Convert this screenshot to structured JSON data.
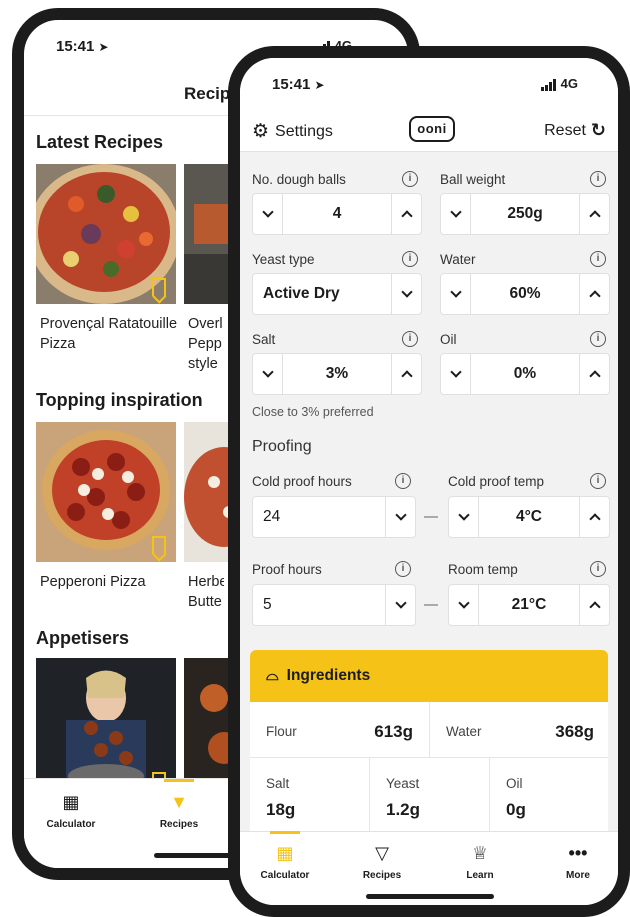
{
  "back_phone": {
    "status": {
      "time": "15:41",
      "network": "4G"
    },
    "header_title": "Recip",
    "sections": [
      {
        "title": "Latest Recipes",
        "cards": [
          {
            "caption": "Provençal Ratatouille Pizza"
          },
          {
            "caption": "Overl Pepp style"
          }
        ]
      },
      {
        "title": "Topping inspiration",
        "cards": [
          {
            "caption": "Pepperoni Pizza"
          },
          {
            "caption": "Herbe Butte"
          }
        ]
      },
      {
        "title": "Appetisers",
        "cards": [
          {
            "caption": ""
          },
          {
            "caption": ""
          }
        ]
      }
    ],
    "tabs": [
      {
        "label": "Calculator",
        "icon": "calculator-icon"
      },
      {
        "label": "Recipes",
        "icon": "pizza-slice-icon",
        "active": true
      }
    ]
  },
  "front_phone": {
    "status": {
      "time": "15:41",
      "network": "4G"
    },
    "nav": {
      "settings_label": "Settings",
      "logo_text": "ooni",
      "reset_label": "Reset"
    },
    "fields": {
      "dough_balls": {
        "label": "No. dough balls",
        "value": "4"
      },
      "ball_weight": {
        "label": "Ball weight",
        "value": "250g"
      },
      "yeast_type": {
        "label": "Yeast type",
        "value": "Active Dry"
      },
      "water": {
        "label": "Water",
        "value": "60%"
      },
      "salt": {
        "label": "Salt",
        "value": "3%"
      },
      "oil": {
        "label": "Oil",
        "value": "0%"
      },
      "salt_hint": "Close to 3% preferred",
      "proofing_title": "Proofing",
      "cold_proof_hours": {
        "label": "Cold proof hours",
        "value": "24"
      },
      "cold_proof_temp": {
        "label": "Cold proof temp",
        "value": "4°C"
      },
      "proof_hours": {
        "label": "Proof hours",
        "value": "5"
      },
      "room_temp": {
        "label": "Room temp",
        "value": "21°C"
      }
    },
    "ingredients": {
      "title": "Ingredients",
      "flour": {
        "name": "Flour",
        "value": "613g"
      },
      "water": {
        "name": "Water",
        "value": "368g"
      },
      "salt": {
        "name": "Salt",
        "value": "18g"
      },
      "yeast": {
        "name": "Yeast",
        "value": "1.2g"
      },
      "oil": {
        "name": "Oil",
        "value": "0g"
      }
    },
    "tabs": [
      {
        "label": "Calculator",
        "icon": "calculator-icon",
        "active": true
      },
      {
        "label": "Recipes",
        "icon": "pizza-slice-icon"
      },
      {
        "label": "Learn",
        "icon": "chef-hat-icon"
      },
      {
        "label": "More",
        "icon": "more-dots-icon"
      }
    ],
    "accent_color": "#f5c318"
  }
}
